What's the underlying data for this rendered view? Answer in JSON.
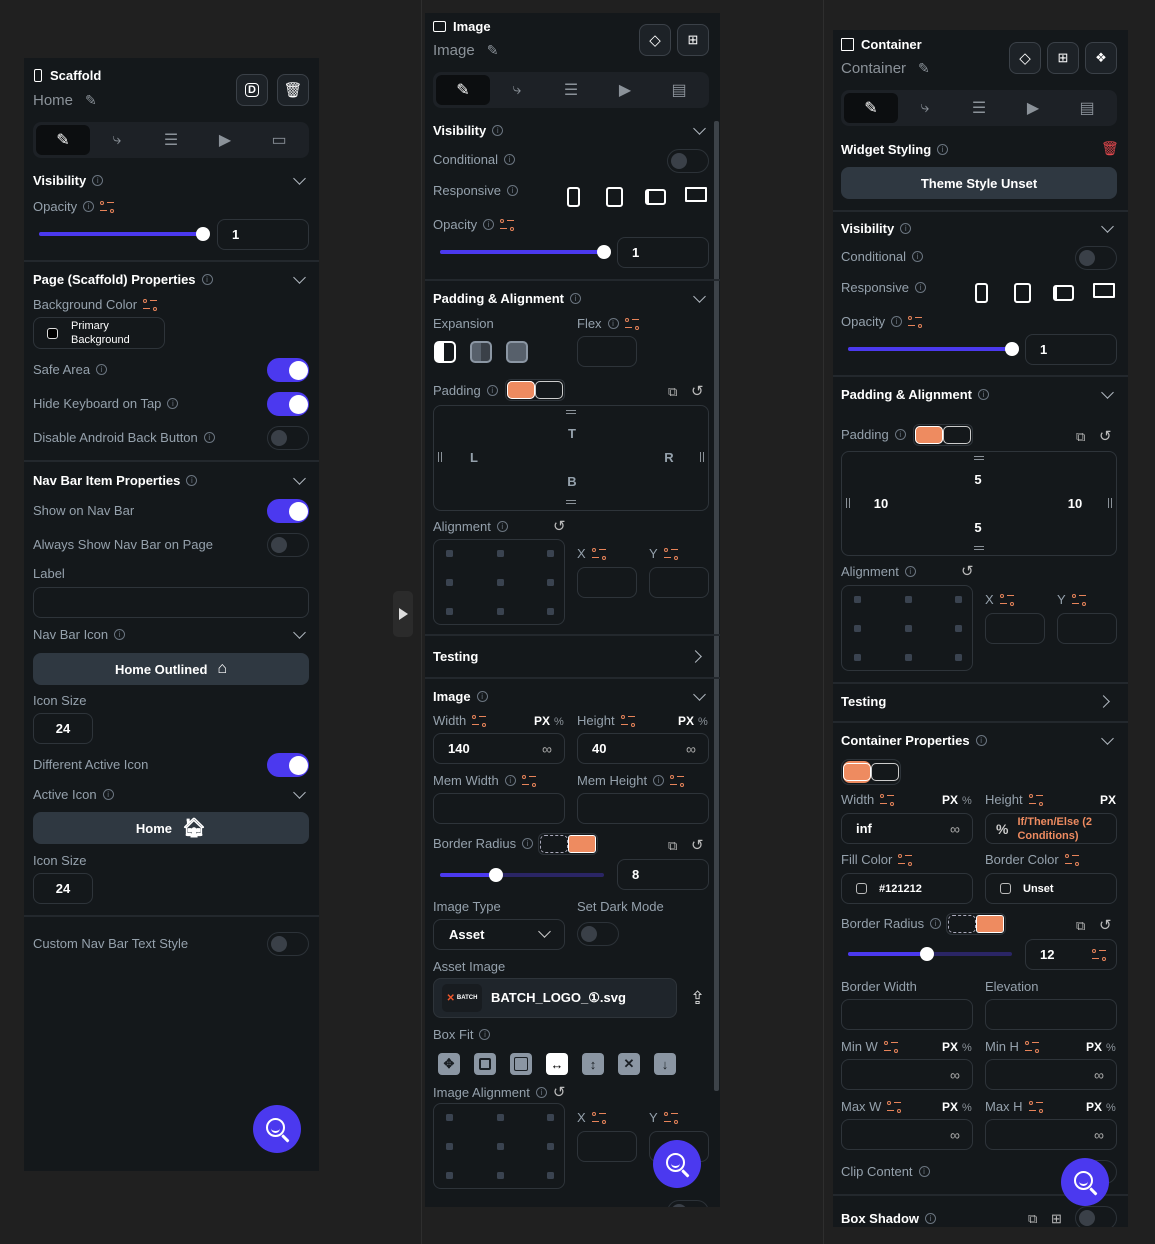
{
  "colors": {
    "accent": "#4b39ef",
    "orange": "#ee8b60",
    "panel_bg": "#14181b",
    "danger": "#e5484d"
  },
  "tabs": [
    {
      "name": "properties",
      "icon": "ruler-pencil-icon",
      "active": true
    },
    {
      "name": "actions",
      "icon": "action-flow-icon"
    },
    {
      "name": "backend-query",
      "icon": "database-icon"
    },
    {
      "name": "animations",
      "icon": "play-icon"
    },
    {
      "name": "extra",
      "icon": "page-add-icon"
    }
  ],
  "scaffold": {
    "type": "Scaffold",
    "name": "Home",
    "visibility": {
      "title": "Visibility",
      "opacity_label": "Opacity",
      "opacity": 1,
      "opacity_value": "1"
    },
    "page_props": {
      "title": "Page (Scaffold) Properties",
      "bg_label": "Background Color",
      "bg_value_line1": "Primary",
      "bg_value_line2": "Background",
      "safe_area": {
        "label": "Safe Area",
        "on": true
      },
      "hide_keyboard": {
        "label": "Hide Keyboard on Tap",
        "on": true
      },
      "disable_back": {
        "label": "Disable Android Back Button",
        "on": false
      }
    },
    "nav": {
      "title": "Nav Bar Item Properties",
      "show": {
        "label": "Show on Nav Bar",
        "on": true
      },
      "always": {
        "label": "Always Show Nav Bar on Page",
        "on": false
      },
      "label_label": "Label",
      "label_value": "",
      "icon_title": "Nav Bar Icon",
      "icon_value": "Home Outlined",
      "icon_size_label": "Icon Size",
      "icon_size": "24",
      "diff_active": {
        "label": "Different Active Icon",
        "on": true
      },
      "active_title": "Active Icon",
      "active_value": "Home",
      "active_size_label": "Icon Size",
      "active_size": "24",
      "custom_text": {
        "label": "Custom Nav Bar Text Style",
        "on": false
      }
    }
  },
  "image": {
    "type": "Image",
    "name": "Image",
    "visibility": {
      "title": "Visibility",
      "conditional": "Conditional",
      "responsive": "Responsive",
      "opacity_label": "Opacity",
      "opacity": 1,
      "opacity_value": "1"
    },
    "padding": {
      "title": "Padding & Alignment",
      "expansion": "Expansion",
      "flex": "Flex",
      "flex_value": "",
      "padding_label": "Padding",
      "t": "T",
      "l": "L",
      "r": "R",
      "b": "B",
      "alignment": "Alignment",
      "x": "X",
      "y": "Y"
    },
    "testing": "Testing",
    "props": {
      "title": "Image",
      "width_label": "Width",
      "width": "140",
      "height_label": "Height",
      "height": "40",
      "unit_px": "PX",
      "unit_pct": "%",
      "mem_width": "Mem Width",
      "mem_height": "Mem Height",
      "radius_label": "Border Radius",
      "radius": "8",
      "radius_fraction": 0.34,
      "type_label": "Image Type",
      "type_value": "Asset",
      "dark_label": "Set Dark Mode",
      "asset_label": "Asset Image",
      "asset_file": "BATCH_LOGO_①.svg",
      "asset_thumb": "BATCH",
      "boxfit_label": "Box Fit",
      "img_align": "Image Alignment",
      "x": "X",
      "y": "Y"
    }
  },
  "container": {
    "type": "Container",
    "name": "Container",
    "styling": {
      "title": "Widget Styling",
      "button": "Theme Style Unset"
    },
    "visibility": {
      "title": "Visibility",
      "conditional": "Conditional",
      "responsive": "Responsive",
      "opacity_label": "Opacity",
      "opacity": 1,
      "opacity_value": "1"
    },
    "padding": {
      "title": "Padding & Alignment",
      "padding_label": "Padding",
      "t": "5",
      "l": "10",
      "r": "10",
      "b": "5",
      "alignment": "Alignment",
      "x": "X",
      "y": "Y"
    },
    "testing": "Testing",
    "props": {
      "title": "Container Properties",
      "width_label": "Width",
      "width": "inf",
      "height_label": "Height",
      "height_cond": "If/Then/Else (2 Conditions)",
      "unit_px": "PX",
      "unit_pct": "%",
      "fill_label": "Fill Color",
      "fill": "#121212",
      "border_color_label": "Border Color",
      "border_color": "Unset",
      "radius_label": "Border Radius",
      "radius": "12",
      "radius_fraction": 0.48,
      "border_width": "Border Width",
      "elevation": "Elevation",
      "min_w": "Min W",
      "min_h": "Min H",
      "max_w": "Max W",
      "max_h": "Max H",
      "clip": "Clip Content",
      "shadow": "Box Shadow"
    }
  },
  "infinity": "∞"
}
